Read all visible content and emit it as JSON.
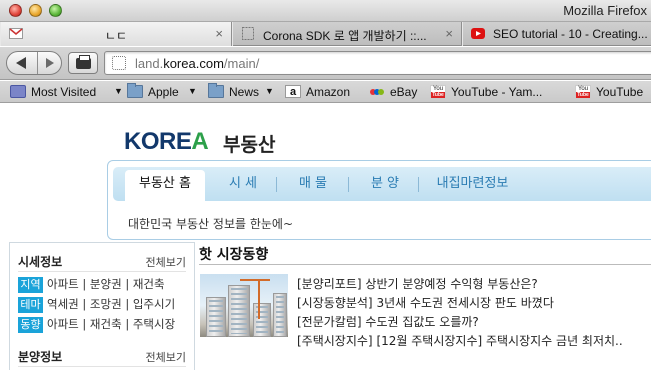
{
  "window": {
    "title": "Mozilla Firefox"
  },
  "tabs": [
    {
      "label": "ㄴㄷ",
      "icon": "gmail-icon",
      "active": true
    },
    {
      "label": "Corona SDK 로 앱 개발하기 ::...",
      "icon": "blank-page-icon",
      "active": false
    },
    {
      "label": "SEO tutorial - 10 - Creating...",
      "icon": "youtube-icon",
      "active": false
    }
  ],
  "close_glyph": "×",
  "toolbar": {
    "url_host": "land.korea.com",
    "url_path": "/main/",
    "url_prefix": "land."
  },
  "bookmarks": [
    {
      "label": "Most Visited",
      "icon": "most-visited-icon",
      "dropdown": true
    },
    {
      "label": "Apple",
      "icon": "folder-icon",
      "dropdown": true
    },
    {
      "label": "News",
      "icon": "folder-icon",
      "dropdown": true
    },
    {
      "label": "Amazon",
      "icon": "amazon-icon",
      "dropdown": false
    },
    {
      "label": "eBay",
      "icon": "ebay-icon",
      "dropdown": false
    },
    {
      "label": "YouTube - Yam...",
      "icon": "youtube-icon",
      "dropdown": false
    },
    {
      "label": "YouTube",
      "icon": "youtube-icon",
      "dropdown": false
    }
  ],
  "site": {
    "logo_text": "KORE",
    "logo_accent": "A",
    "logo_sub": "부동산",
    "nav": [
      "부동산 홈",
      "시 세",
      "매 물",
      "분 양",
      "내집마련정보"
    ],
    "tagline": "대한민국 부동산 정보를 한눈에~"
  },
  "sidebar": {
    "section1": {
      "title": "시세정보",
      "more": "전체보기",
      "rows": [
        {
          "tag": "지역",
          "text": "아파트 | 분양권 | 재건축"
        },
        {
          "tag": "테마",
          "text": "역세권 | 조망권 | 입주시기"
        },
        {
          "tag": "동향",
          "text": "아파트 | 재건축 | 주택시장"
        }
      ]
    },
    "section2": {
      "title": "분양정보",
      "more": "전체보기"
    }
  },
  "hot": {
    "title": "핫 시장동향",
    "items": [
      {
        "category": "[분양리포트]",
        "text": "상반기 분양예정 수익형 부동산은?"
      },
      {
        "category": "[시장동향분석]",
        "text": "3년새 수도권 전세시장 판도 바꼈다"
      },
      {
        "category": "[전문가칼럼]",
        "text": "수도권 집값도 오를까?"
      },
      {
        "category": "[주택시장지수]",
        "text": "[12월 주택시장지수] 주택시장지수 금년 최저치.."
      }
    ]
  },
  "colors": {
    "logo_blue": "#12386b",
    "logo_green": "#2ca04a",
    "nav_blue": "#2a7cb3",
    "tag_blue": "#1aa3d9"
  }
}
